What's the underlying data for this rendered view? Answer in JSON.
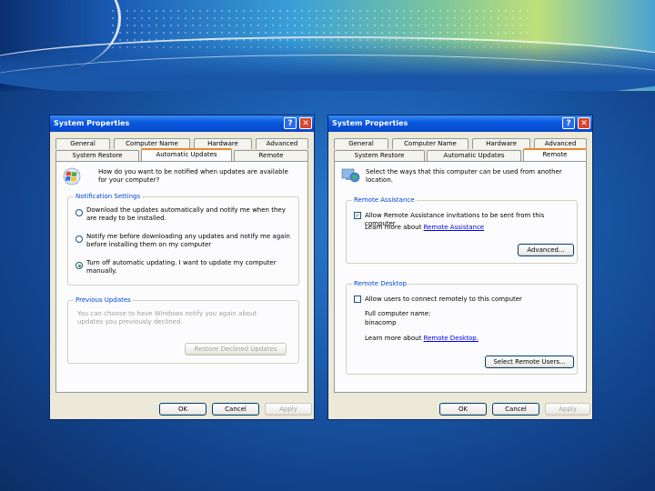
{
  "left_window": {
    "title": "System Properties",
    "tabs_row1": [
      "General",
      "Computer Name",
      "Hardware",
      "Advanced"
    ],
    "tabs_row2": [
      "System Restore",
      "Automatic Updates",
      "Remote"
    ],
    "active_tab": "Automatic Updates",
    "intro": "How do you want to be notified when updates are available for your computer?",
    "notification_group": {
      "label": "Notification Settings",
      "options": [
        "Download the updates automatically and notify me when they are ready to be installed.",
        "Notify me before downloading any updates and notify me again before installing them on my computer",
        "Turn off automatic updating. I want to update my computer manually."
      ],
      "selected": 2
    },
    "previous_group": {
      "label": "Previous Updates",
      "text": "You can choose to have Windows notify you again about updates you previously declined.",
      "button": "Restore Declined Updates"
    },
    "buttons": {
      "ok": "OK",
      "cancel": "Cancel",
      "apply": "Apply"
    }
  },
  "right_window": {
    "title": "System Properties",
    "tabs_row1": [
      "General",
      "Computer Name",
      "Hardware",
      "Advanced"
    ],
    "tabs_row2": [
      "System Restore",
      "Automatic Updates",
      "Remote"
    ],
    "active_tab": "Remote",
    "intro": "Select the ways that this computer can be used from another location.",
    "assistance_group": {
      "label": "Remote Assistance",
      "checkbox": "Allow Remote Assistance invitations to be sent from this computer",
      "checked": true,
      "learn_prefix": "Learn more about",
      "learn_link": "Remote Assistance",
      "button": "Advanced..."
    },
    "desktop_group": {
      "label": "Remote Desktop",
      "checkbox": "Allow users to connect remotely to this computer",
      "checked": false,
      "name_label": "Full computer name:",
      "name_value": "binacomp",
      "learn_prefix": "Learn more about",
      "learn_link": "Remote Desktop.",
      "button": "Select Remote Users..."
    },
    "buttons": {
      "ok": "OK",
      "cancel": "Cancel",
      "apply": "Apply"
    }
  },
  "title_buttons": {
    "help": "?",
    "close": "✕"
  },
  "colors": {
    "titlebar": "#0a5ae0",
    "dialog": "#ece9d8",
    "group_label": "#0046d5",
    "active_tab_accent": "#e68b2c"
  },
  "icons": [
    "help-icon",
    "close-icon",
    "windows-logo-icon",
    "globe-computer-icon"
  ]
}
